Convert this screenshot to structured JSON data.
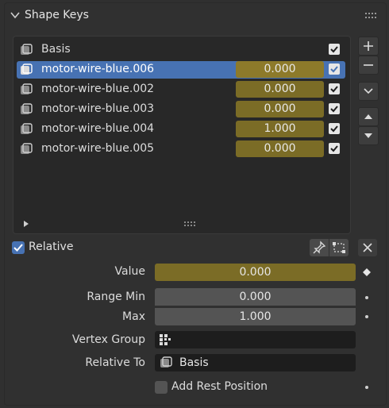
{
  "panel": {
    "title": "Shape Keys"
  },
  "shape_keys": [
    {
      "name": "Basis",
      "value": "",
      "checked": true,
      "selected": false
    },
    {
      "name": "motor-wire-blue.006",
      "value": "0.000",
      "checked": true,
      "selected": true
    },
    {
      "name": "motor-wire-blue.002",
      "value": "0.000",
      "checked": true,
      "selected": false
    },
    {
      "name": "motor-wire-blue.003",
      "value": "0.000",
      "checked": true,
      "selected": false
    },
    {
      "name": "motor-wire-blue.004",
      "value": "1.000",
      "checked": true,
      "selected": false
    },
    {
      "name": "motor-wire-blue.005",
      "value": "0.000",
      "checked": true,
      "selected": false
    }
  ],
  "relative": {
    "label": "Relative",
    "checked": true
  },
  "props": {
    "value": {
      "label": "Value",
      "value": "0.000"
    },
    "range_min": {
      "label": "Range Min",
      "value": "0.000"
    },
    "max": {
      "label": "Max",
      "value": "1.000"
    },
    "vertex_group": {
      "label": "Vertex Group",
      "value": ""
    },
    "relative_to": {
      "label": "Relative To",
      "value": "Basis"
    },
    "add_rest_position": {
      "label": "Add Rest Position",
      "checked": false
    }
  },
  "colors": {
    "background": "#303030",
    "selected_row": "#4772b3",
    "value_slider": "#7b6c26"
  }
}
